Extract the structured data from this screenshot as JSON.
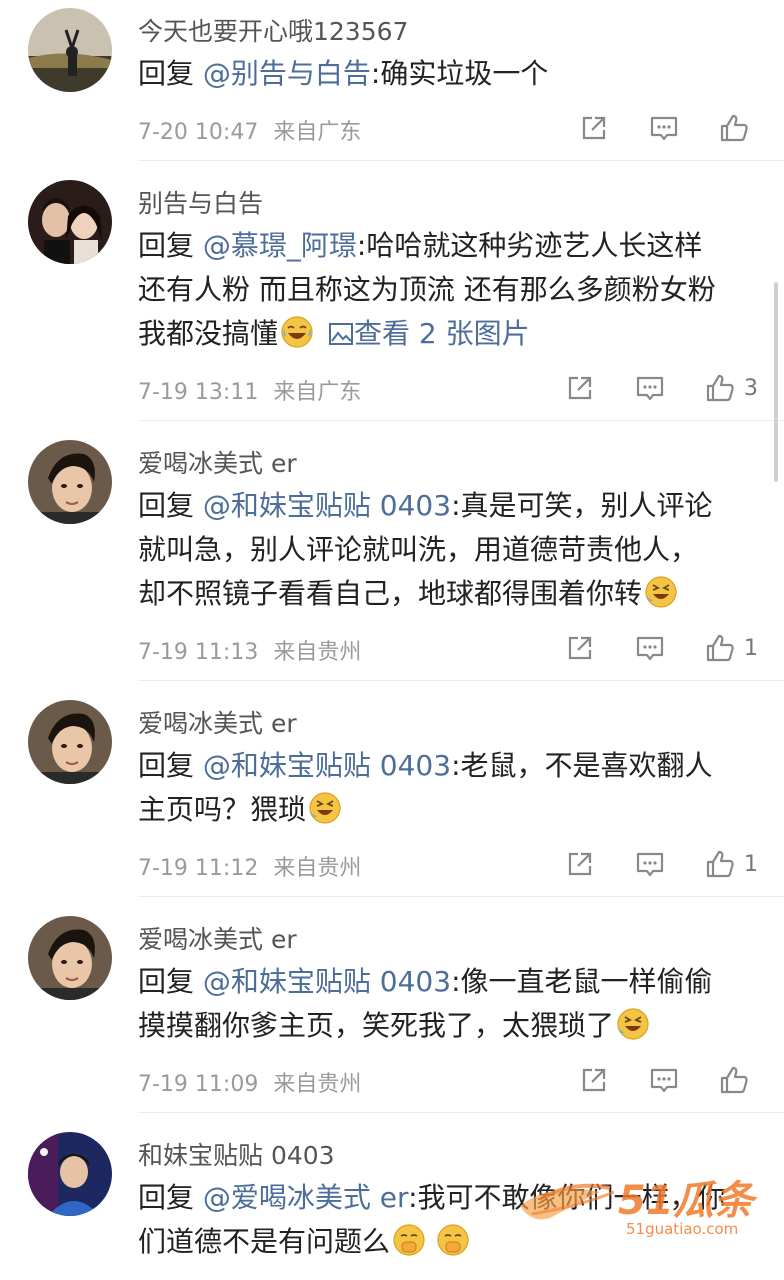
{
  "comments": [
    {
      "username": "今天也要开心哦123567",
      "reply_prefix": "回复 ",
      "mention": "@别告与白告",
      "text": ":确实垃圾一个",
      "time": "7-20 10:47",
      "location": "来自广东",
      "like_count": ""
    },
    {
      "username": "别告与白告",
      "reply_prefix": "回复 ",
      "mention": "@慕璟_阿璟",
      "text_line1": ":哈哈就这种劣迹艺人长这样",
      "text_line2": "还有人粉 而且称这为顶流 还有那么多颜粉女粉",
      "text_line3": "我都没搞懂",
      "image_link": "查看 2 张图片",
      "time": "7-19 13:11",
      "location": "来自广东",
      "like_count": "3"
    },
    {
      "username": "爱喝冰美式 er",
      "reply_prefix": "回复 ",
      "mention": "@和妹宝贴贴 0403",
      "text_line1": ":真是可笑，别人评论",
      "text_line2": "就叫急，别人评论就叫洗，用道德苛责他人，",
      "text_line3": "却不照镜子看看自己，地球都得围着你转",
      "time": "7-19 11:13",
      "location": "来自贵州",
      "like_count": "1"
    },
    {
      "username": "爱喝冰美式 er",
      "reply_prefix": "回复 ",
      "mention": "@和妹宝贴贴 0403",
      "text_line1": ":老鼠，不是喜欢翻人",
      "text_line2": "主页吗？猥琐",
      "time": "7-19 11:12",
      "location": "来自贵州",
      "like_count": "1"
    },
    {
      "username": "爱喝冰美式 er",
      "reply_prefix": "回复 ",
      "mention": "@和妹宝贴贴 0403",
      "text_line1": ":像一直老鼠一样偷偷",
      "text_line2": "摸摸翻你爹主页，笑死我了，太猥琐了",
      "time": "7-19 11:09",
      "location": "来自贵州",
      "like_count": ""
    },
    {
      "username": "和妹宝贴贴 0403",
      "reply_prefix": "回复 ",
      "mention": "@爱喝冰美式 er",
      "text_line1": ":我可不敢像你们一样，你",
      "text_line2": "们道德不是有问题么"
    }
  ],
  "icons": {
    "share": "share-icon",
    "comment": "comment-icon",
    "like": "thumbs-up-icon",
    "image": "image-icon"
  },
  "watermark": {
    "text": "51瓜条",
    "url": "51guatiao.com"
  },
  "colors": {
    "mention": "#4e6e9a",
    "meta": "#9a9a9a",
    "watermark": "#f07a2b"
  }
}
